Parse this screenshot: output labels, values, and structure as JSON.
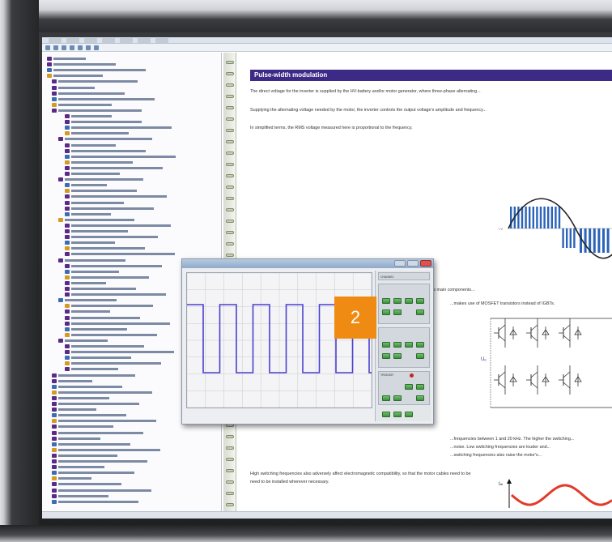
{
  "document": {
    "title": "Pulse-width modulation",
    "paragraph_1": "The direct voltage for the inverter is supplied by the HV-battery and/or motor generator, where three-phase alternating...",
    "paragraph_2": "Supplying the alternating voltage needed by the motor, the inverter controls the output voltage's amplitude and frequency...",
    "paragraph_3": "In simplified terms, the RMS voltage measured here is proportional to the frequency.",
    "paragraph_4": "In the low and medium power ranges, IGBTs (insulated-gate bipolar transistors) are an inverter's main components...",
    "paragraph_5": "...makes use of MOSFET transistors instead of IGBTs.",
    "paragraph_6": "...frequencies between 1 and 20 kHz. The higher the switching...",
    "paragraph_7": "...noise. Low switching frequencies are louder and...",
    "paragraph_8": "...switching frequencies also raise the motor's...",
    "paragraph_9": "High switching frequencies also adversely affect electromagnetic compatibility, so that the motor cables need to be",
    "paragraph_10": "need to be installed wherever necessary.",
    "pwm_axis_label": "0 V",
    "circuit_voltage_label": "Uₑ",
    "graph_axis_label": "Iₘ"
  },
  "badge": {
    "number": "2"
  },
  "colors": {
    "title_bar": "#3d2a86",
    "pwm_bars": "#2b63b8",
    "sine": "#222222",
    "current_wave": "#e23b2a",
    "scope_trace": "#4b3fcf",
    "badge": "#ef8a12",
    "panel_buttons": "#4ea24e"
  },
  "scope": {
    "channel_indicator": "CHANNEL",
    "trigger": "TRIGGER"
  }
}
